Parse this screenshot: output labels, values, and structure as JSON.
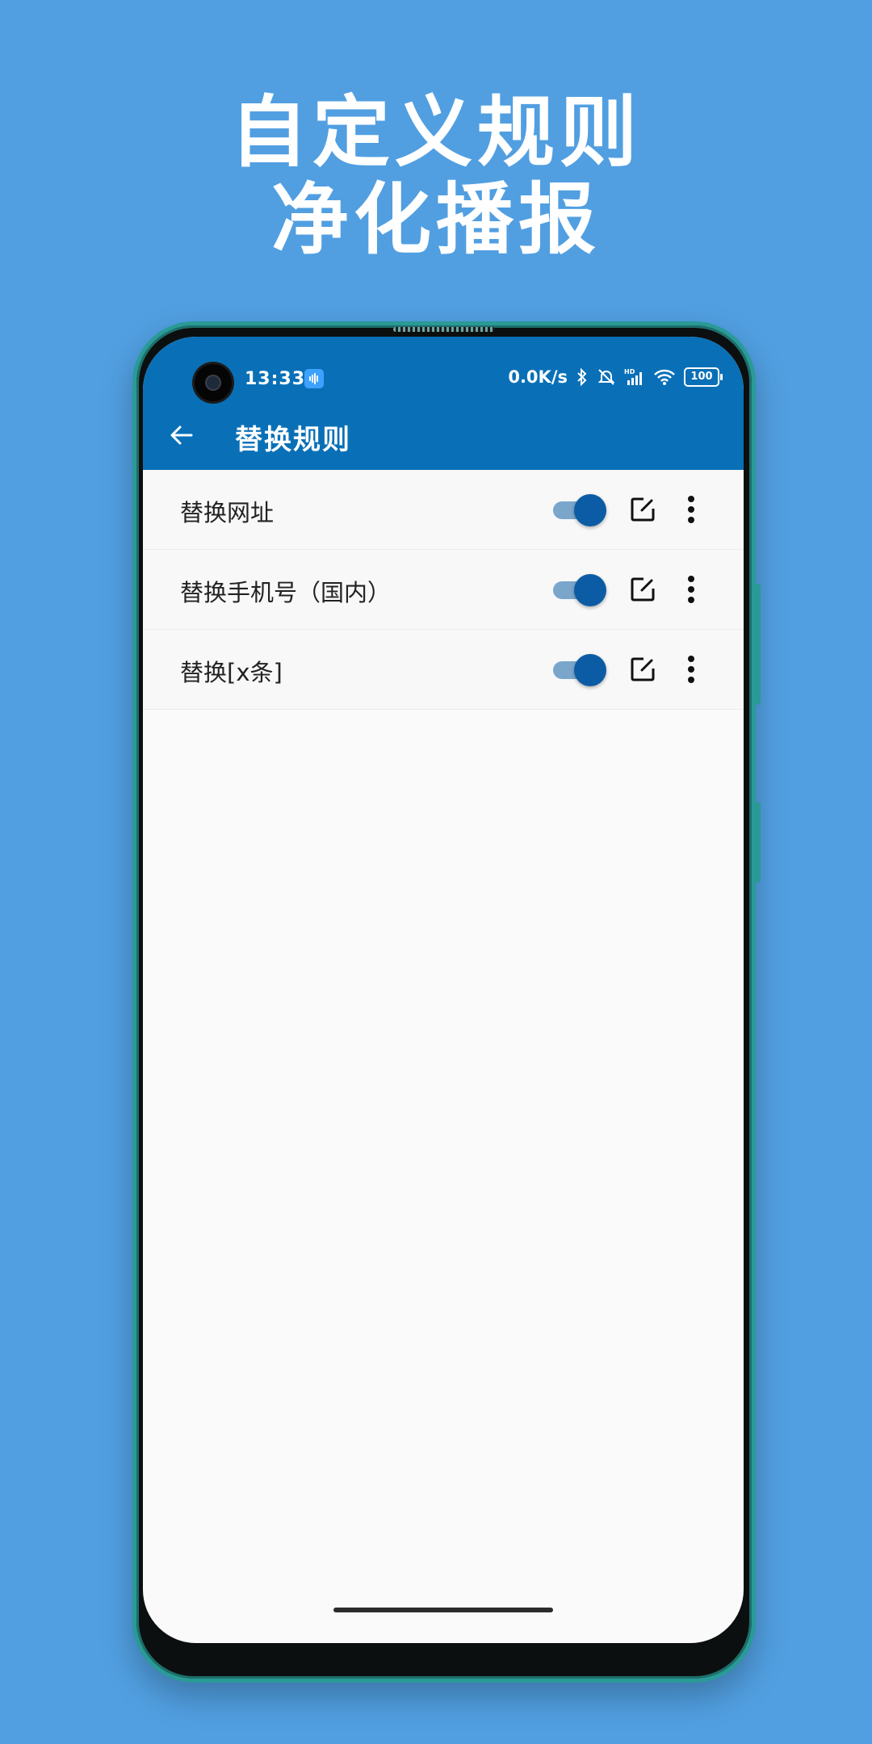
{
  "promo": {
    "line1": "自定义规则",
    "line2": "净化播报"
  },
  "status_bar": {
    "time": "13:33",
    "network_speed": "0.0K/s",
    "battery": "100",
    "icons": [
      "voice-notification-icon",
      "bluetooth-icon",
      "mute-icon",
      "hd-signal-icon",
      "wifi-icon",
      "battery-icon"
    ]
  },
  "app_bar": {
    "title": "替换规则",
    "back_icon": "arrow-left-icon"
  },
  "rules": [
    {
      "label": "替换网址",
      "enabled": true
    },
    {
      "label": "替换手机号（国内）",
      "enabled": true
    },
    {
      "label": "替换[x条]",
      "enabled": true
    }
  ],
  "colors": {
    "background": "#519fe1",
    "app_bar": "#0970b7",
    "switch_thumb": "#0c5ca5",
    "switch_track": "#7aa6cc",
    "phone_frame": "#2a9a96"
  }
}
